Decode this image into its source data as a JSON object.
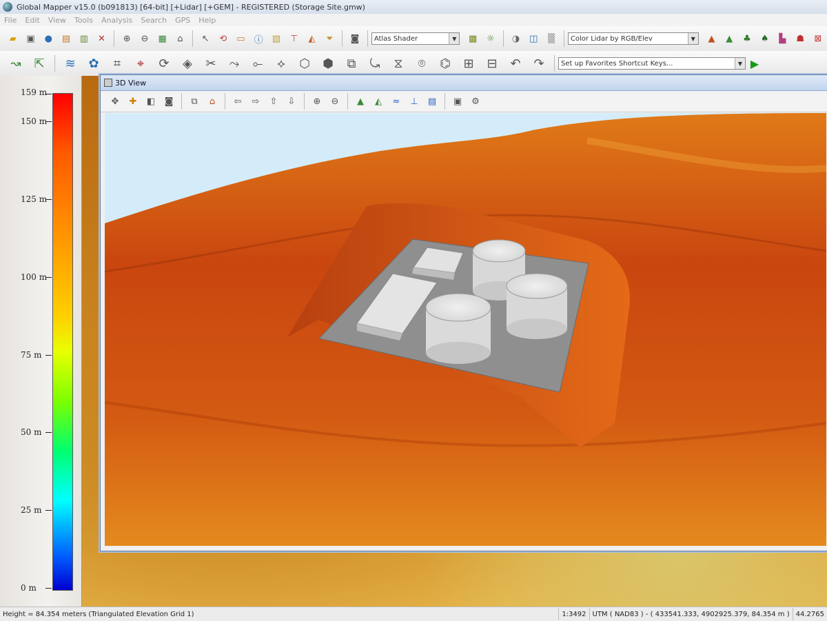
{
  "window": {
    "title": "Global Mapper v15.0 (b091813) [64-bit] [+Lidar] [+GEM] - REGISTERED (Storage Site.gmw)"
  },
  "menu": [
    "File",
    "Edit",
    "View",
    "Tools",
    "Analysis",
    "Search",
    "GPS",
    "Help"
  ],
  "toolbar": {
    "shader_select": "Atlas Shader",
    "lidar_select": "Color Lidar by RGB/Elev",
    "favorites_select": "Set up Favorites Shortcut Keys..."
  },
  "legend": {
    "labels": [
      "159 m",
      "150 m",
      "125 m",
      "100 m",
      "75 m",
      "50 m",
      "25 m",
      "0 m"
    ]
  },
  "view3d": {
    "title": "3D View",
    "icons": [
      "pan-icon",
      "move-icon",
      "zoom-box-icon",
      "binoculars-icon",
      "copy-icon",
      "home-icon",
      "arrow-left-icon",
      "arrow-right-icon",
      "arrow-up-icon",
      "arrow-down-icon",
      "zoom-in-icon",
      "zoom-out-icon",
      "terrain-icon",
      "terrain-shaded-icon",
      "water-icon",
      "vertical-icon",
      "layers-icon",
      "save-icon",
      "settings-icon"
    ]
  },
  "status": {
    "left": "Height = 84.354 meters (Triangulated Elevation Grid 1)",
    "scale": "1:3492",
    "coords": "UTM ( NAD83 ) - ( 433541.333, 4902925.379, 84.354 m )",
    "extra": "44.2765"
  },
  "colors": {
    "sky": "#d4ecfa",
    "terrain_dark": "#b33a0c",
    "terrain_light": "#f0a020",
    "pad": "#8f8f8f",
    "tank": "#e6e6e6"
  }
}
